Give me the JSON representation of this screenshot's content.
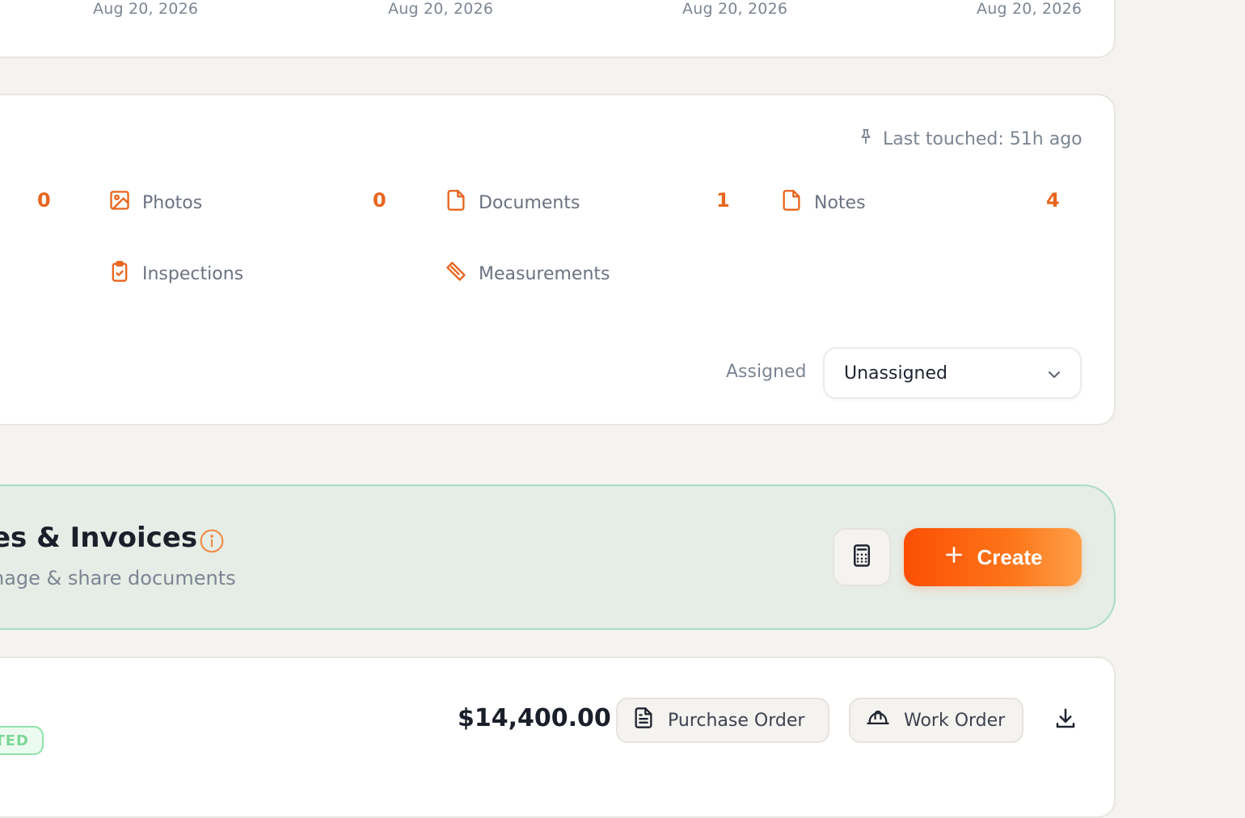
{
  "top_card": {
    "dates": [
      "Aug 20, 2026",
      "Aug 20, 2026",
      "Aug 20, 2026",
      "Aug 20, 2026"
    ]
  },
  "activity": {
    "last_touched": "Last touched: 51h ago",
    "stats": [
      {
        "label": "",
        "count": "0",
        "icon": "hidden"
      },
      {
        "label": "Photos",
        "count": "0",
        "icon": "image-icon"
      },
      {
        "label": "Documents",
        "count": "1",
        "icon": "document-icon"
      },
      {
        "label": "Notes",
        "count": "4",
        "icon": "note-icon"
      },
      {
        "label": "Inspections",
        "count": "",
        "icon": "clipboard-check-icon"
      },
      {
        "label": "Measurements",
        "count": "",
        "icon": "ruler-icon"
      }
    ],
    "assigned_label": "Assigned",
    "assigned_value": "Unassigned"
  },
  "documents_section": {
    "title": "es & Invoices",
    "subtitle": "nage & share documents",
    "create_label": "Create"
  },
  "document_row": {
    "status": "TED",
    "amount": "$14,400.00",
    "purchase_order_label": "Purchase Order",
    "work_order_label": "Work Order"
  },
  "colors": {
    "accent": "#e8651e",
    "create_gradient_start": "#fb4f05",
    "create_gradient_end": "#ffa04a",
    "section_bg": "#e5ede6",
    "section_border": "#a7dcc4",
    "status_green": "#7bd796"
  }
}
